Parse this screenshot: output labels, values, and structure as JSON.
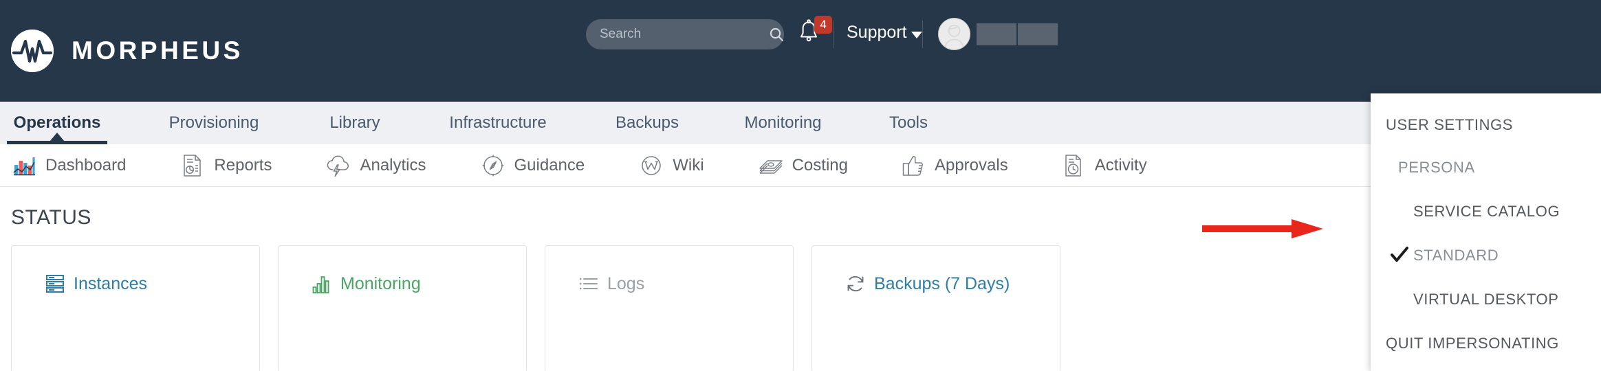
{
  "brand": {
    "name": "MORPHEUS",
    "logo_icon": "morpheus-waveform-logo"
  },
  "header": {
    "search": {
      "placeholder": "Search",
      "value": "",
      "icon": "search-icon"
    },
    "notifications": {
      "icon": "bell-icon",
      "count": "4"
    },
    "support": {
      "label": "Support",
      "caret_icon": "caret-down-icon"
    },
    "avatar": {
      "icon": "user-avatar-icon"
    },
    "username_redacted": ""
  },
  "primary_nav": {
    "items": [
      {
        "label": "Operations",
        "active": true
      },
      {
        "label": "Provisioning",
        "active": false
      },
      {
        "label": "Library",
        "active": false
      },
      {
        "label": "Infrastructure",
        "active": false
      },
      {
        "label": "Backups",
        "active": false
      },
      {
        "label": "Monitoring",
        "active": false
      },
      {
        "label": "Tools",
        "active": false
      }
    ]
  },
  "sub_nav": {
    "items": [
      {
        "label": "Dashboard",
        "icon": "bar-chart-icon"
      },
      {
        "label": "Reports",
        "icon": "report-document-icon"
      },
      {
        "label": "Analytics",
        "icon": "cloud-lightning-icon"
      },
      {
        "label": "Guidance",
        "icon": "compass-icon"
      },
      {
        "label": "Wiki",
        "icon": "wiki-w-circle-icon"
      },
      {
        "label": "Costing",
        "icon": "money-stack-icon"
      },
      {
        "label": "Approvals",
        "icon": "thumbs-up-icon"
      },
      {
        "label": "Activity",
        "icon": "document-clock-icon"
      }
    ]
  },
  "main": {
    "status_heading": "STATUS",
    "cards": [
      {
        "label": "Instances",
        "icon": "server-stack-icon",
        "color": "#2e7ca8"
      },
      {
        "label": "Monitoring",
        "icon": "green-bar-chart-icon",
        "color": "#4aa564"
      },
      {
        "label": "Logs",
        "icon": "list-lines-icon",
        "color": "#9aa0a6"
      },
      {
        "label": "Backups (7 Days)",
        "icon": "refresh-cycle-icon",
        "color": "#2e7ca8"
      }
    ]
  },
  "user_menu": {
    "items": [
      {
        "label": "USER SETTINGS",
        "level": 0,
        "checked": false
      },
      {
        "label": "PERSONA",
        "level": 1,
        "checked": false
      },
      {
        "label": "SERVICE CATALOG",
        "level": 2,
        "checked": false
      },
      {
        "label": "STANDARD",
        "level": 2,
        "checked": true
      },
      {
        "label": "VIRTUAL DESKTOP",
        "level": 2,
        "checked": false
      },
      {
        "label": "QUIT IMPERSONATING",
        "level": 0,
        "checked": false
      }
    ],
    "check_icon": "checkmark-icon"
  },
  "annotation": {
    "arrow_icon": "red-arrow-right",
    "color": "#e8261c"
  },
  "colors": {
    "header_bg": "#26374a",
    "nav_bg": "#eff0f3",
    "accent_red": "#c0392b",
    "link_blue": "#2e7ca8"
  }
}
